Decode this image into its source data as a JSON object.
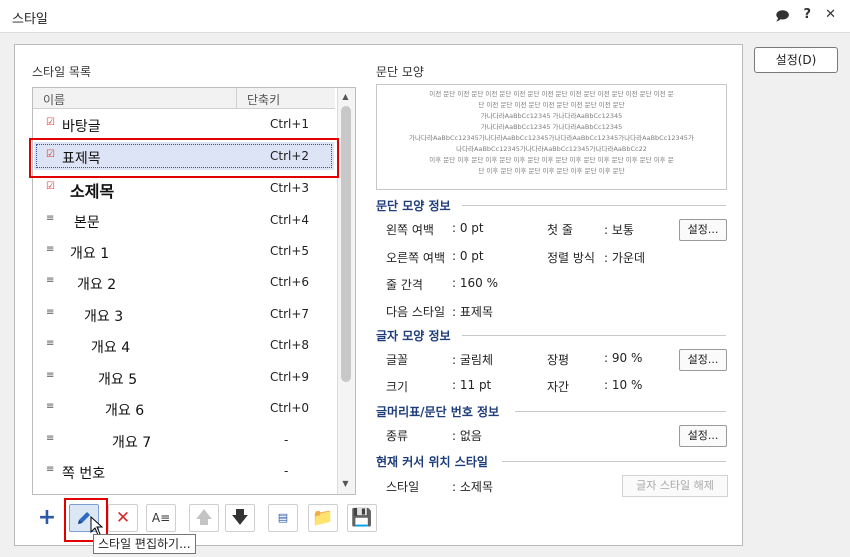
{
  "window": {
    "title": "스타일",
    "icons": [
      "chat-icon",
      "help-icon",
      "close-icon"
    ]
  },
  "top_button": "설정(D)",
  "style_list": {
    "label": "스타일 목록",
    "col_name": "이름",
    "col_shortcut": "단축키",
    "items": [
      {
        "name": "바탕글",
        "shortcut": "Ctrl+1",
        "icon": "check-pen-icon"
      },
      {
        "name": "표제목",
        "shortcut": "Ctrl+2",
        "icon": "check-pen-icon",
        "selected": true
      },
      {
        "name": "소제목",
        "shortcut": "Ctrl+3",
        "icon": "check-pen-icon"
      },
      {
        "name": "본문",
        "shortcut": "Ctrl+4",
        "icon": "paragraph-icon"
      },
      {
        "name": "개요 1",
        "shortcut": "Ctrl+5",
        "icon": "paragraph-icon"
      },
      {
        "name": "개요 2",
        "shortcut": "Ctrl+6",
        "icon": "paragraph-icon"
      },
      {
        "name": "개요 3",
        "shortcut": "Ctrl+7",
        "icon": "paragraph-icon"
      },
      {
        "name": "개요 4",
        "shortcut": "Ctrl+8",
        "icon": "paragraph-icon"
      },
      {
        "name": "개요 5",
        "shortcut": "Ctrl+9",
        "icon": "paragraph-icon"
      },
      {
        "name": "개요 6",
        "shortcut": "Ctrl+0",
        "icon": "paragraph-icon"
      },
      {
        "name": "개요 7",
        "shortcut": "-",
        "icon": "paragraph-icon"
      },
      {
        "name": "쪽 번호",
        "shortcut": "-",
        "icon": "paragraph-icon"
      }
    ]
  },
  "preview": {
    "label": "문단 모양",
    "lines": [
      "이전 문단 이전 문단 이전 문단 이전 문단 이전 문단 이전 문단 이전 문단 이전 문단 이전 문",
      "단 이전 문단 이전 문단 이전 문단 이전 문단 이전 문단",
      "가나다라AaBbCc12345 가나다라AaBbCc12345",
      "가나다라AaBbCc12345 가나다라AaBbCc12345",
      "가나다라AaBbCc12345가나다라AaBbCc12345가나다라AaBbCc12345가나다라AaBbCc12345가",
      "나다라AaBbCc12345가나다라AaBbCc12345가나다라AaBbCc22",
      "이후 문단 이후 문단 이후 문단 이후 문단 이후 문단 이후 문단 이후 문단 이후 문단 이후 문",
      "단 이후 문단 이후 문단 이후 문단 이후 문단 이후 문단"
    ]
  },
  "para_info": {
    "title": "문단 모양 정보",
    "left_margin_label": "왼쪽 여백",
    "left_margin": ": 0 pt",
    "first_line_label": "첫 줄",
    "first_line": ": 보통",
    "right_margin_label": "오른쪽 여백",
    "right_margin": ": 0 pt",
    "align_label": "정렬 방식",
    "align": ": 가운데",
    "line_spacing_label": "줄 간격",
    "line_spacing": ": 160 %",
    "next_style_label": "다음 스타일",
    "next_style": ": 표제목",
    "settings_button": "설정..."
  },
  "char_info": {
    "title": "글자 모양 정보",
    "font_label": "글꼴",
    "font": ": 굴림체",
    "ratio_label": "장평",
    "ratio": ": 90 %",
    "size_label": "크기",
    "size": ": 11 pt",
    "spacing_label": "자간",
    "spacing": ": 10 %",
    "settings_button": "설정..."
  },
  "bullet_info": {
    "title": "글머리표/문단 번호 정보",
    "type_label": "종류",
    "type": ": 없음",
    "settings_button": "설정..."
  },
  "cursor_style": {
    "title": "현재 커서 위치 스타일",
    "style_label": "스타일",
    "style": ": 소제목",
    "clear_button": "글자 스타일 해제"
  },
  "toolbar": {
    "tooltip": "스타일 편집하기...",
    "buttons": [
      "add-icon",
      "edit-icon",
      "delete-icon",
      "replace-icon",
      "move-up-icon",
      "move-down-icon",
      "import-icon",
      "open-folder-icon",
      "save-icon"
    ]
  },
  "colors": {
    "accent": "#1f3d7a",
    "highlight_box": "#e00000",
    "selected_row": "#dce4f5"
  }
}
